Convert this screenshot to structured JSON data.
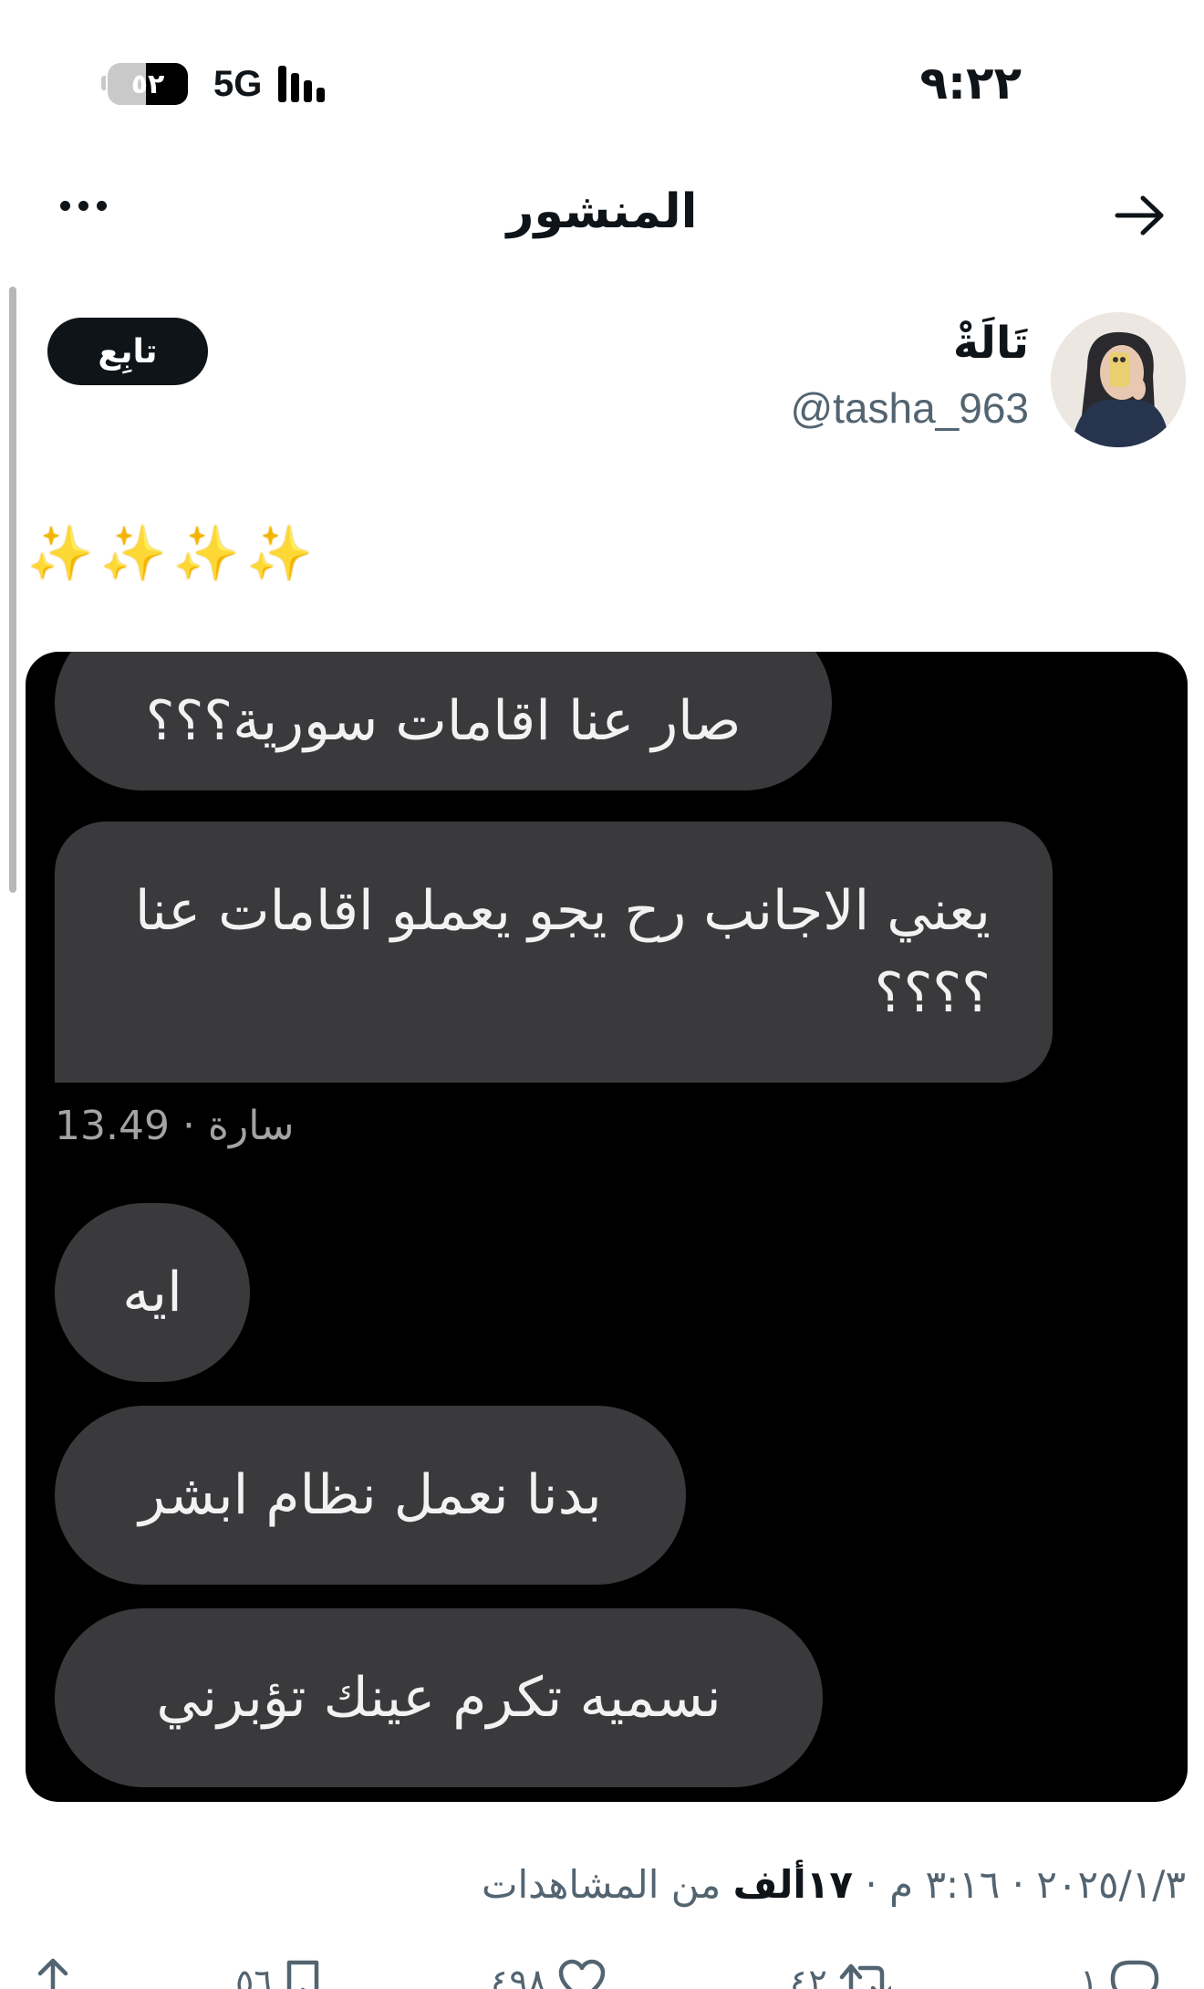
{
  "status": {
    "time": "٩:٢٢",
    "network": "5G",
    "battery": "٥٢",
    "battery_level": 0.52
  },
  "header": {
    "title": "المنشور"
  },
  "author": {
    "name": "تَالَةْ",
    "handle": "@tasha_963",
    "follow_label": "تابِع"
  },
  "post": {
    "text": "✨✨✨✨",
    "chat_image": {
      "bubble_1": "صار عنا اقامات سورية؟؟؟",
      "bubble_2": "يعني الاجانب رح يجو يعملو اقامات عنا ؟؟؟؟",
      "meta": "13.49 · سارة",
      "bubble_3": "ايه",
      "bubble_4": "بدنا نعمل نظام ابشر",
      "bubble_5": "نسميه تكرم عينك تؤبرني"
    },
    "date": "٢٠٢٥/١/٣",
    "time": "٣:١٦ م",
    "separator": " · ",
    "views": "١٧ألف",
    "views_label": "من المشاهدات"
  },
  "actions": {
    "replies": "١",
    "reposts": "٤٢",
    "likes": "٤٩٨",
    "bookmarks": "٥٦"
  },
  "icons": [
    "back-arrow-icon",
    "more-icon",
    "reply-icon",
    "repost-icon",
    "like-icon",
    "bookmark-icon",
    "share-icon"
  ]
}
